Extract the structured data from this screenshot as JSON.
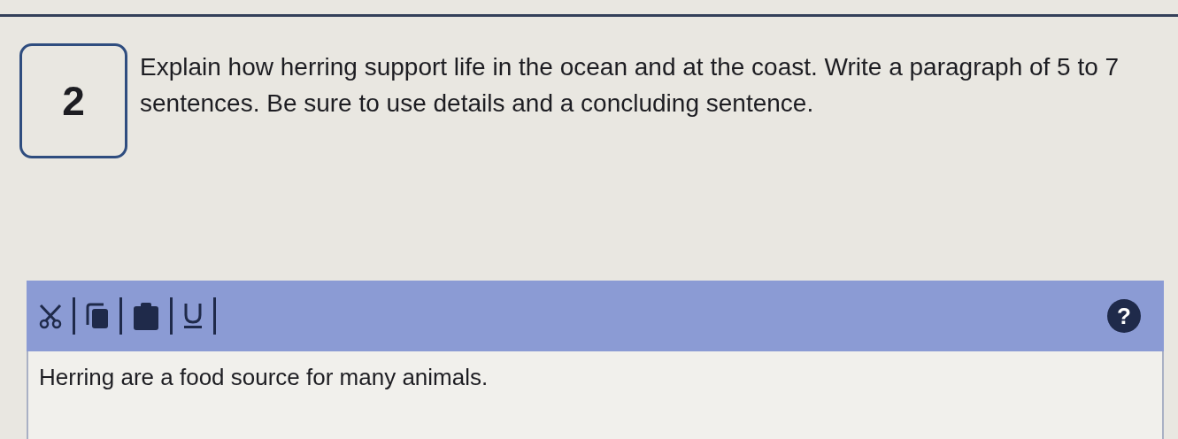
{
  "question": {
    "number": "2",
    "prompt": "Explain how herring support life in the ocean and at the coast. Write a paragraph of 5 to 7 sentences. Be sure to use details and a concluding sentence."
  },
  "editor": {
    "tools": [
      {
        "kind": "cut"
      },
      {
        "kind": "copy"
      },
      {
        "kind": "paste"
      },
      {
        "kind": "underline"
      }
    ],
    "help": "?",
    "answer": "Herring are a food source for many animals."
  }
}
